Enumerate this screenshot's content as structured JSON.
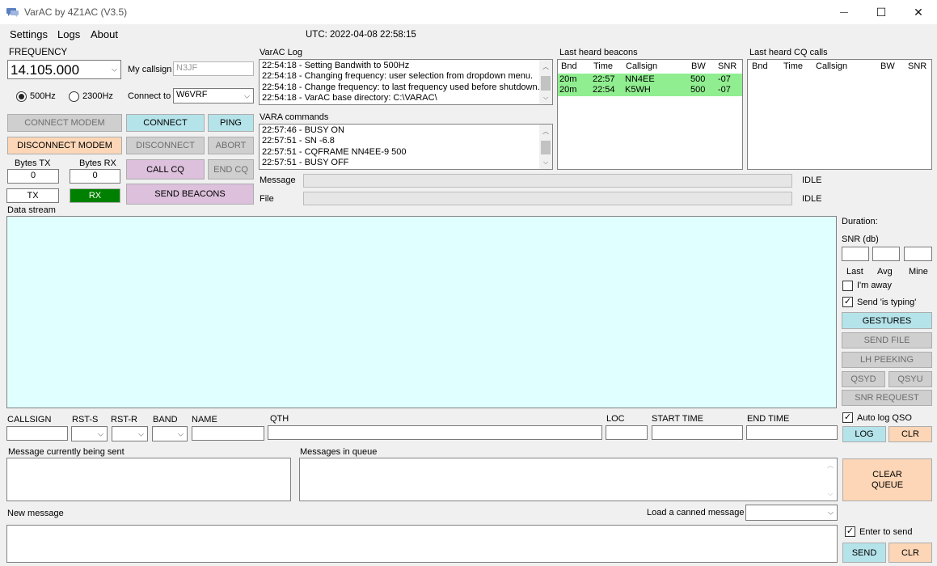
{
  "window": {
    "title": "VarAC by 4Z1AC (V3.5)",
    "minimize": "—",
    "maximize": "☐",
    "close": "✕"
  },
  "menu": {
    "settings": "Settings",
    "logs": "Logs",
    "about": "About"
  },
  "utc": "UTC: 2022-04-08 22:58:15",
  "frequency": {
    "label": "FREQUENCY",
    "value": "14.105.000",
    "bw_500": "500Hz",
    "bw_2300": "2300Hz",
    "selected_bw": "500Hz"
  },
  "station": {
    "my_callsign_label": "My callsign",
    "my_callsign_value": "N3JF",
    "connect_to_label": "Connect to",
    "connect_to_value": "W6VRF"
  },
  "buttons": {
    "connect_modem": "CONNECT MODEM",
    "disconnect_modem": "DISCONNECT MODEM",
    "connect": "CONNECT",
    "ping": "PING",
    "disconnect": "DISCONNECT",
    "abort": "ABORT",
    "call_cq": "CALL CQ",
    "end_cq": "END CQ",
    "send_beacons": "SEND BEACONS",
    "tx": "TX",
    "rx": "RX",
    "gestures": "GESTURES",
    "send_file": "SEND FILE",
    "lh_peeking": "LH PEEKING",
    "qsyd": "QSYD",
    "qsyu": "QSYU",
    "snr_request": "SNR REQUEST",
    "log": "LOG",
    "clr": "CLR",
    "clear_queue_1": "CLEAR",
    "clear_queue_2": "QUEUE",
    "send": "SEND",
    "clr2": "CLR"
  },
  "counters": {
    "bytes_tx_label": "Bytes TX",
    "bytes_tx": "0",
    "bytes_rx_label": "Bytes RX",
    "bytes_rx": "0"
  },
  "varac_log": {
    "label": "VarAC Log",
    "lines": [
      "22:54:18 - Setting Bandwith to 500Hz",
      "22:54:18 - Changing frequency: user selection from dropdown menu.",
      "22:54:18 - Change frequency: to last frequency used before shutdown.",
      "22:54:18 - VarAC base directory: C:\\VARAC\\"
    ]
  },
  "vara_commands": {
    "label": "VARA commands",
    "lines": [
      "22:57:46 - BUSY ON",
      "22:57:51 - SN -6.8",
      "22:57:51 - CQFRAME NN4EE-9 500",
      "22:57:51 - BUSY OFF"
    ]
  },
  "beacons": {
    "label": "Last heard beacons",
    "headers": [
      "Bnd",
      "Time",
      "Callsign",
      "BW",
      "SNR"
    ],
    "rows": [
      [
        "20m",
        "22:57",
        "NN4EE",
        "500",
        "-07"
      ],
      [
        "20m",
        "22:54",
        "K5WH",
        "500",
        "-07"
      ]
    ]
  },
  "cq_calls": {
    "label": "Last heard CQ calls",
    "headers": [
      "Bnd",
      "Time",
      "Callsign",
      "BW",
      "SNR"
    ]
  },
  "status": {
    "message_label": "Message",
    "message_state": "IDLE",
    "file_label": "File",
    "file_state": "IDLE"
  },
  "datastream_label": "Data stream",
  "side": {
    "duration_label": "Duration:",
    "snr_label": "SNR (db)",
    "last": "Last",
    "avg": "Avg",
    "mine": "Mine",
    "im_away": "I'm away",
    "im_away_checked": false,
    "send_typing": "Send 'is typing'",
    "send_typing_checked": true,
    "auto_log": "Auto log QSO",
    "auto_log_checked": true,
    "enter_to_send": "Enter to send",
    "enter_to_send_checked": true
  },
  "qso": {
    "callsign": "CALLSIGN",
    "rst_s": "RST-S",
    "rst_r": "RST-R",
    "band": "BAND",
    "name": "NAME",
    "qth": "QTH",
    "loc": "LOC",
    "start_time": "START TIME",
    "end_time": "END TIME"
  },
  "messages": {
    "current_label": "Message currently being sent",
    "queue_label": "Messages in queue",
    "new_label": "New message",
    "canned_label": "Load a canned message"
  },
  "icons": {
    "check": "✓",
    "down": "⌵",
    "up": "︿"
  },
  "colors": {
    "cyan_button": "#b5e3ea",
    "peach_button": "#fcd6b6",
    "lilac_button": "#dcc0dc",
    "rx_green": "#008000",
    "beacon_row": "#90ee90",
    "datastream_bg": "#e0ffff"
  }
}
